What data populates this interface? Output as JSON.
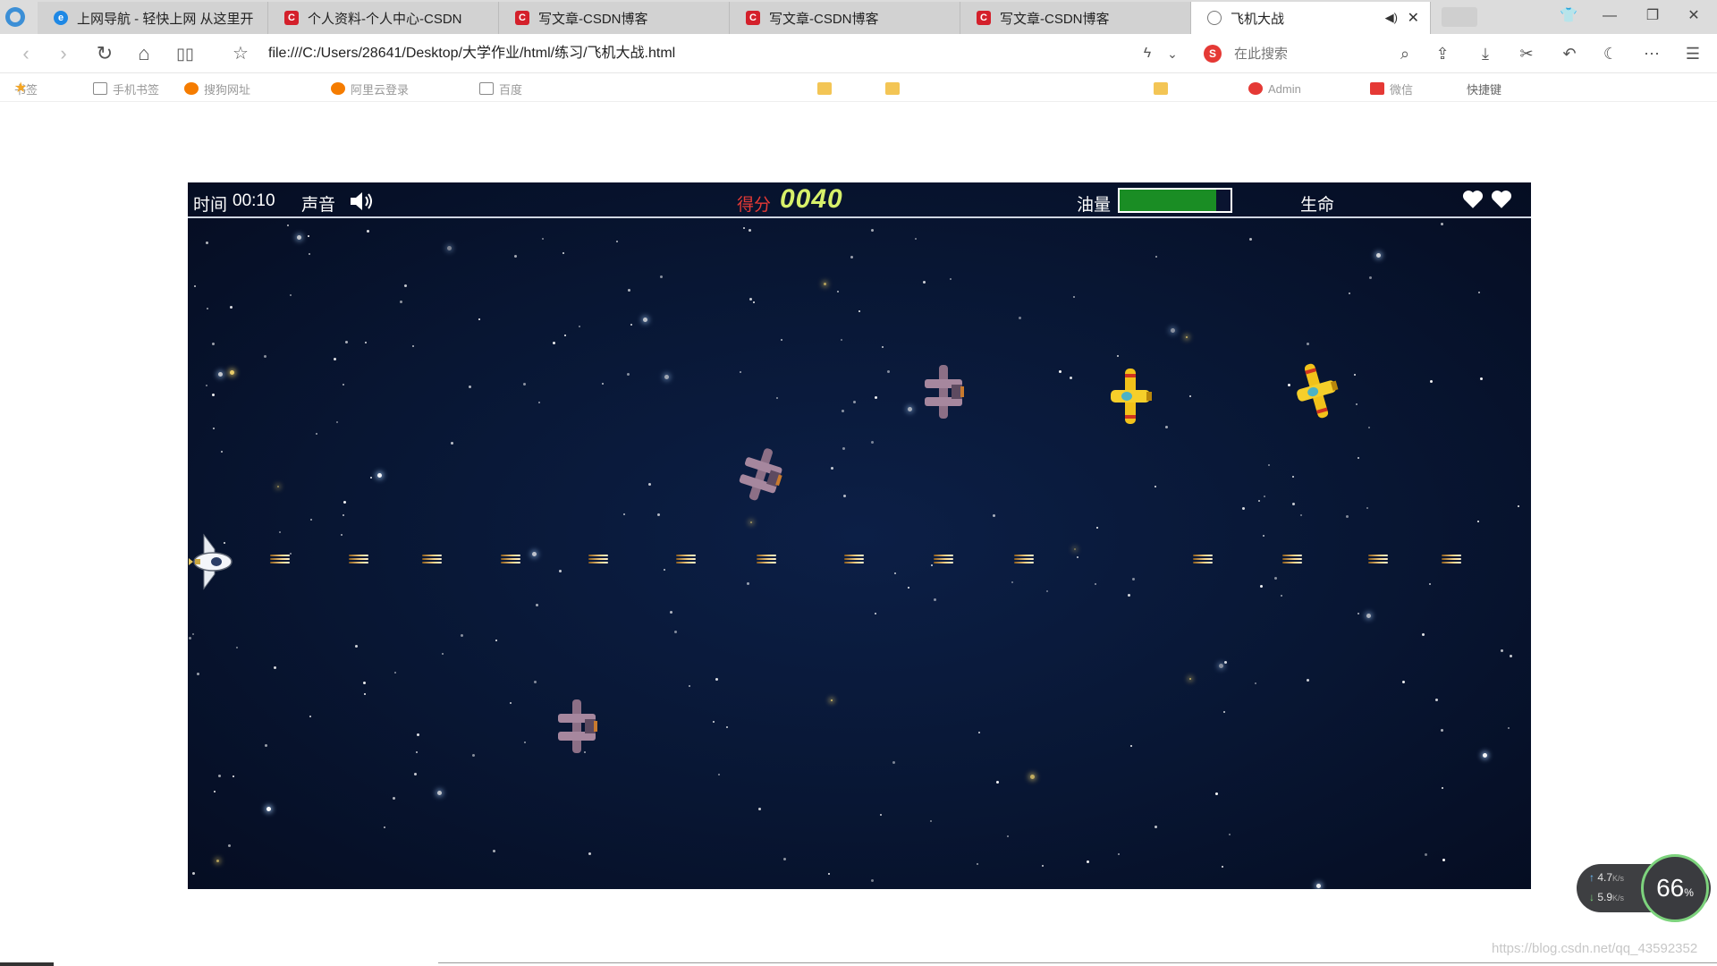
{
  "browser": {
    "tabs": [
      {
        "title": "上网导航 - 轻快上网 从这里开",
        "icon": "ie-icon",
        "active": false
      },
      {
        "title": "个人资料-个人中心-CSDN",
        "icon": "csdn-icon",
        "active": false
      },
      {
        "title": "写文章-CSDN博客",
        "icon": "csdn-icon",
        "active": false
      },
      {
        "title": "写文章-CSDN博客",
        "icon": "csdn-icon",
        "active": false
      },
      {
        "title": "写文章-CSDN博客",
        "icon": "csdn-icon",
        "active": false
      },
      {
        "title": "飞机大战",
        "icon": "globe-icon",
        "active": true
      }
    ],
    "address": "file:///C:/Users/28641/Desktop/大学作业/html/练习/飞机大战.html",
    "search_placeholder": "在此搜索",
    "bookmarks": [
      "书签",
      "手机书签",
      "搜狗网址",
      "阿里云登录",
      "百度",
      "Admin",
      "微信",
      "快捷键"
    ]
  },
  "game": {
    "time_label": "时间",
    "time_value": "00:10",
    "sound_label": "声音",
    "score_label": "得分",
    "score_value": "0040",
    "fuel_label": "油量",
    "fuel_fraction": 0.87,
    "life_label": "生命",
    "lives": 2,
    "colors": {
      "score_value": "#d7f06a",
      "score_label": "#e53935",
      "fuel": "#1a8d24"
    }
  },
  "net_widget": {
    "upload": "4.7",
    "download": "5.9",
    "unit": "K/s",
    "cpu_value": "66",
    "cpu_unit": "%"
  },
  "watermark": "https://blog.csdn.net/qq_43592352"
}
